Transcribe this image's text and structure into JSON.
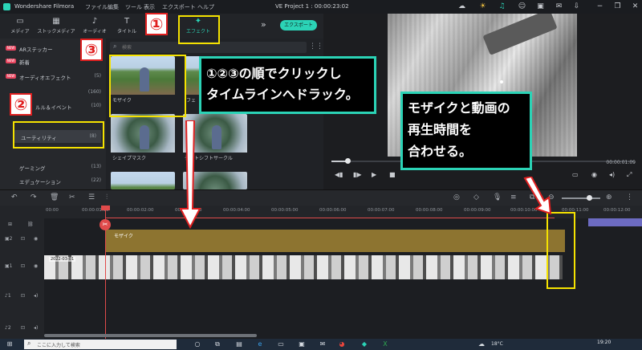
{
  "titlebar": {
    "app_name": "Wondershare Filmora",
    "menus": [
      "ファイル",
      "編集",
      "ツール",
      "表示",
      "エクスポート",
      "ヘルプ"
    ],
    "project": "VE Project 1 : 00:00:23:02"
  },
  "tabs": [
    {
      "label": "メディア",
      "icon": "folder-icon"
    },
    {
      "label": "ストックメディア",
      "icon": "stock-icon"
    },
    {
      "label": "オーディオ",
      "icon": "music-icon"
    },
    {
      "label": "タイトル",
      "icon": "title-icon"
    },
    {
      "label": "エフェクト",
      "icon": "effects-icon"
    }
  ],
  "export_label": "エクスポート",
  "sidebar": {
    "items": [
      {
        "label": "ARステッカー",
        "count": "",
        "badge": "NEW"
      },
      {
        "label": "新着",
        "count": "",
        "badge": "NEW"
      },
      {
        "label": "オーディオエフェクト",
        "count": "(5)",
        "badge": "NEW"
      },
      {
        "label": "",
        "count": "(160)",
        "badge": ""
      },
      {
        "label": "ルル＆イベント",
        "count": "(10)",
        "badge": ""
      },
      {
        "label": "",
        "count": "",
        "badge": ""
      },
      {
        "label": "ユーティリティ",
        "count": "(8)",
        "badge": ""
      },
      {
        "label": "",
        "count": "",
        "badge": ""
      },
      {
        "label": "ゲーミング",
        "count": "(13)",
        "badge": ""
      },
      {
        "label": "エデュケーション",
        "count": "(22)",
        "badge": ""
      }
    ]
  },
  "search": {
    "placeholder": "検索"
  },
  "effects": [
    {
      "label": "モザイク"
    },
    {
      "label": "フェ"
    },
    {
      "label": "シェイプマスク"
    },
    {
      "label": "チルトシフトサークル"
    }
  ],
  "preview": {
    "timecode": "00:00:01:09"
  },
  "timeline": {
    "ticks": [
      "00:00",
      "00:00:01:00",
      "00:00:02:00",
      "00:00:03:00",
      "00:00:04:00",
      "00:00:05:00",
      "00:00:06:00",
      "00:00:07:00",
      "00:00:08:00",
      "00:00:09:00",
      "00:00:10:00",
      "00:00:11:00",
      "00:00:12:00"
    ],
    "effect_clip_label": "モザイク",
    "video_clip_label": "2022-03-01"
  },
  "taskbar": {
    "search_text": "ここに入力して検索",
    "temp": "18°C",
    "clock": "19:20"
  },
  "annotations": {
    "n1": "①",
    "n2": "②",
    "n3": "③",
    "callout1_line1": "①②③の順でクリックし",
    "callout1_line2": "タイムラインへドラック。",
    "callout2_line1": "モザイクと動画の",
    "callout2_line2": "再生時間を",
    "callout2_line3": "合わせる。"
  },
  "colors": {
    "accent": "#2bd3b6",
    "highlight": "#f5e200",
    "playhead": "#e04b4b",
    "effect_clip": "#8d7430"
  }
}
